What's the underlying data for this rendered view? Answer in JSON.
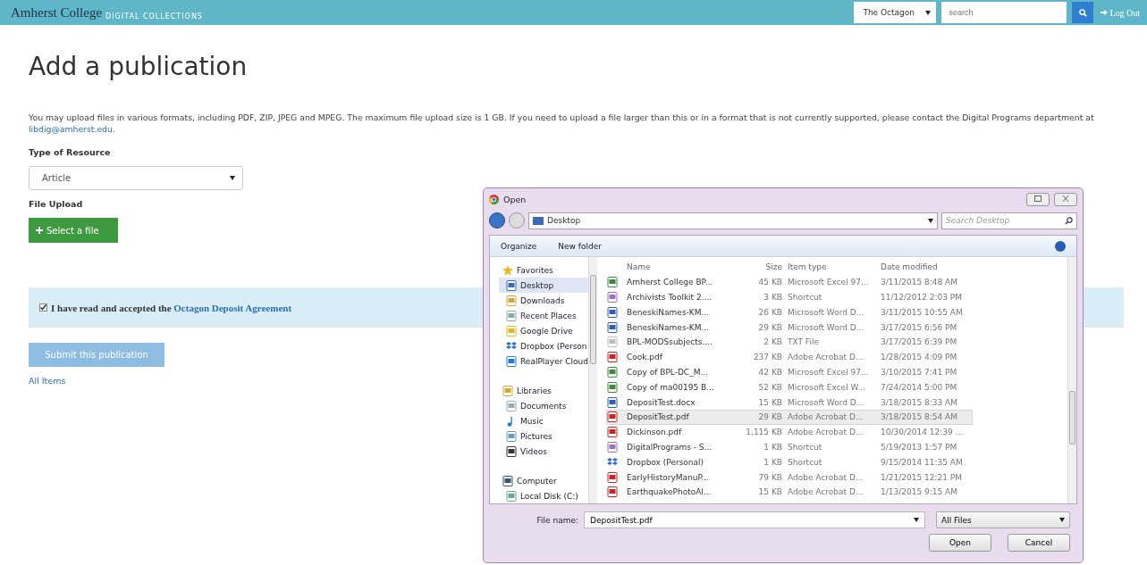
{
  "header": {
    "brand": "Amherst College",
    "brand_sub": "DIGITAL COLLECTIONS",
    "collection": "The Octagon",
    "search_placeholder": "search",
    "logout": "Log Out"
  },
  "page": {
    "title": "Add a publication",
    "intro": "You may upload files in various formats, including PDF, ZIP, JPEG and MPEG. The maximum file upload size is 1 GB. If you need to upload a file larger than this or in a format that is not currently supported, please contact the Digital Programs department at ",
    "intro_link": "libdig@amherst.edu",
    "intro_end": ".",
    "type_label": "Type of Resource",
    "type_value": "Article",
    "upload_label": "File Upload",
    "select_button": "Select a file",
    "agreement_checked": true,
    "agreement_text": "I have read and accepted the ",
    "agreement_link": "Octagon Deposit Agreement",
    "submit": "Submit this publication",
    "all_items": "All Items"
  },
  "dialog": {
    "title": "Open",
    "address": "Desktop",
    "search_placeholder": "Search Desktop",
    "toolbar": [
      "Organize",
      "New folder"
    ],
    "nav": [
      {
        "label": "Favorites",
        "kind": "star",
        "children": [
          {
            "label": "Desktop",
            "kind": "desktop",
            "selected": true
          },
          {
            "label": "Downloads",
            "kind": "folder",
            "selected": false
          },
          {
            "label": "Recent Places",
            "kind": "recent",
            "selected": false
          },
          {
            "label": "Google Drive",
            "kind": "drive",
            "selected": false
          },
          {
            "label": "Dropbox (Person",
            "kind": "dropbox",
            "selected": false
          },
          {
            "label": "RealPlayer Cloud",
            "kind": "cloud",
            "selected": false
          }
        ]
      },
      {
        "label": "Libraries",
        "kind": "library",
        "children": [
          {
            "label": "Documents",
            "kind": "doc",
            "selected": false
          },
          {
            "label": "Music",
            "kind": "music",
            "selected": false
          },
          {
            "label": "Pictures",
            "kind": "pictures",
            "selected": false
          },
          {
            "label": "Videos",
            "kind": "video",
            "selected": false
          }
        ]
      },
      {
        "label": "Computer",
        "kind": "computer",
        "children": [
          {
            "label": "Local Disk (C:)",
            "kind": "disk",
            "selected": false
          }
        ]
      }
    ],
    "columns": [
      "Name",
      "Size",
      "Item type",
      "Date modified"
    ],
    "rows": [
      {
        "name": "Amherst College BP...",
        "size": "45 KB",
        "type": "Microsoft Excel 97...",
        "date": "3/11/2015 8:48 AM",
        "kind": "excel",
        "selected": false
      },
      {
        "name": "Archivists Toolkit 2....",
        "size": "3 KB",
        "type": "Shortcut",
        "date": "11/12/2012 2:03 PM",
        "kind": "shortcut",
        "selected": false
      },
      {
        "name": "BeneskiNames-KM...",
        "size": "26 KB",
        "type": "Microsoft Word D...",
        "date": "3/11/2015 10:55 AM",
        "kind": "word",
        "selected": false
      },
      {
        "name": "BeneskiNames-KM...",
        "size": "29 KB",
        "type": "Microsoft Word D...",
        "date": "3/17/2015 6:56 PM",
        "kind": "word",
        "selected": false
      },
      {
        "name": "BPL-MODSsubjects....",
        "size": "2 KB",
        "type": "TXT File",
        "date": "3/17/2015 6:39 PM",
        "kind": "text",
        "selected": false
      },
      {
        "name": "Cook.pdf",
        "size": "237 KB",
        "type": "Adobe Acrobat D...",
        "date": "1/28/2015 4:09 PM",
        "kind": "pdf",
        "selected": false
      },
      {
        "name": "Copy of BPL-DC_M...",
        "size": "42 KB",
        "type": "Microsoft Excel 97...",
        "date": "3/10/2015 7:41 PM",
        "kind": "excel",
        "selected": false
      },
      {
        "name": "Copy of ma00195 B...",
        "size": "52 KB",
        "type": "Microsoft Excel W...",
        "date": "7/24/2014 5:00 PM",
        "kind": "excel",
        "selected": false
      },
      {
        "name": "DepositTest.docx",
        "size": "15 KB",
        "type": "Microsoft Word D...",
        "date": "3/18/2015 8:33 AM",
        "kind": "word",
        "selected": false
      },
      {
        "name": "DepositTest.pdf",
        "size": "29 KB",
        "type": "Adobe Acrobat D...",
        "date": "3/18/2015 8:54 AM",
        "kind": "pdf",
        "selected": true
      },
      {
        "name": "Dickinson.pdf",
        "size": "1,115 KB",
        "type": "Adobe Acrobat D...",
        "date": "10/30/2014 12:39 ...",
        "kind": "pdf",
        "selected": false
      },
      {
        "name": "DigitalPrograms - S...",
        "size": "1 KB",
        "type": "Shortcut",
        "date": "5/19/2013 1:57 PM",
        "kind": "shortcut",
        "selected": false
      },
      {
        "name": "Dropbox (Personal)",
        "size": "1 KB",
        "type": "Shortcut",
        "date": "9/15/2014 11:35 AM",
        "kind": "dropbox",
        "selected": false
      },
      {
        "name": "EarlyHistoryManuP...",
        "size": "79 KB",
        "type": "Adobe Acrobat D...",
        "date": "1/21/2015 12:21 PM",
        "kind": "pdf",
        "selected": false
      },
      {
        "name": "EarthquakePhotoAl...",
        "size": "15 KB",
        "type": "Adobe Acrobat D...",
        "date": "1/13/2015 9:15 AM",
        "kind": "pdf",
        "selected": false
      }
    ],
    "filename_label": "File name:",
    "filename": "DepositTest.pdf",
    "filter": "All Files",
    "open": "Open",
    "cancel": "Cancel"
  }
}
